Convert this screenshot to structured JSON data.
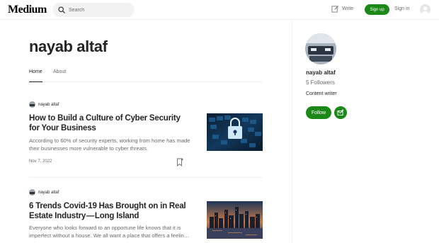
{
  "header": {
    "logo": "Medium",
    "search_placeholder": "Search",
    "write_label": "Write",
    "signup_label": "Sign up",
    "signin_label": "Sign in"
  },
  "profile": {
    "name": "nayab altaf",
    "tabs": [
      {
        "label": "Home",
        "active": true
      },
      {
        "label": "About",
        "active": false
      }
    ]
  },
  "articles": [
    {
      "author": "nayab altaf",
      "title": "How to Build a Culture of Cyber Security for Your Business",
      "subtitle": "According to 60% of security experts, working from home has made their businesses more vulnerable to cyber threats.",
      "date": "Nov 7, 2022"
    },
    {
      "author": "nayab altaf",
      "title": "6 Trends Covid-19 Has Brought on in Real Estate Industry — Long Island",
      "subtitle": "Everyone who looks forward to an opportune life knows that it is imperfect without a house. We all want a place that offers a feelin…"
    }
  ],
  "sidebar": {
    "name": "nayab altaf",
    "followers": "5 Followers",
    "bio": "Content writer",
    "follow_label": "Follow"
  },
  "colors": {
    "accent": "#1a8917",
    "text": "#242424",
    "muted": "#6b6b6b"
  },
  "icons": [
    "search-icon",
    "write-icon",
    "bookmark-icon",
    "subscribe-icon",
    "user-avatar-icon"
  ]
}
